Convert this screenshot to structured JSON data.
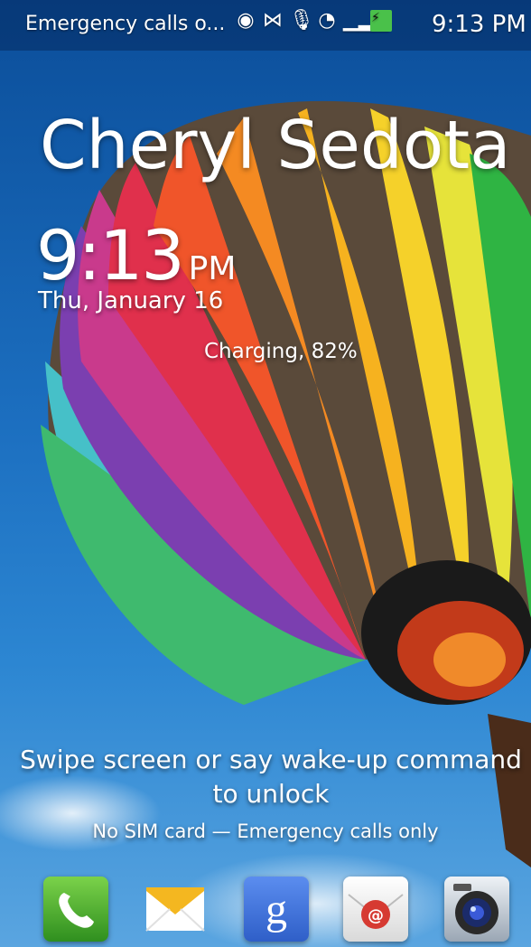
{
  "status_bar": {
    "notification_text": "Emergency calls o...",
    "icons": [
      "eye-icon",
      "nfc-icon",
      "microphone-icon",
      "wifi-icon",
      "signal-icon",
      "battery-charging-icon"
    ],
    "time": "9:13 PM"
  },
  "lock_screen": {
    "owner_name": "Cheryl Sedota",
    "time": "9:13",
    "ampm": "PM",
    "date": "Thu, January 16",
    "charging_status": "Charging, 82%",
    "unlock_hint": "Swipe screen or say wake-up command to unlock",
    "sim_status": "No SIM card — Emergency calls only"
  },
  "dock": {
    "apps": [
      "phone-app-icon",
      "messages-app-icon",
      "google-app-icon",
      "email-app-icon",
      "camera-app-icon"
    ]
  },
  "colors": {
    "sky": "#1c6fc0",
    "battery_green": "#4ac14a"
  }
}
